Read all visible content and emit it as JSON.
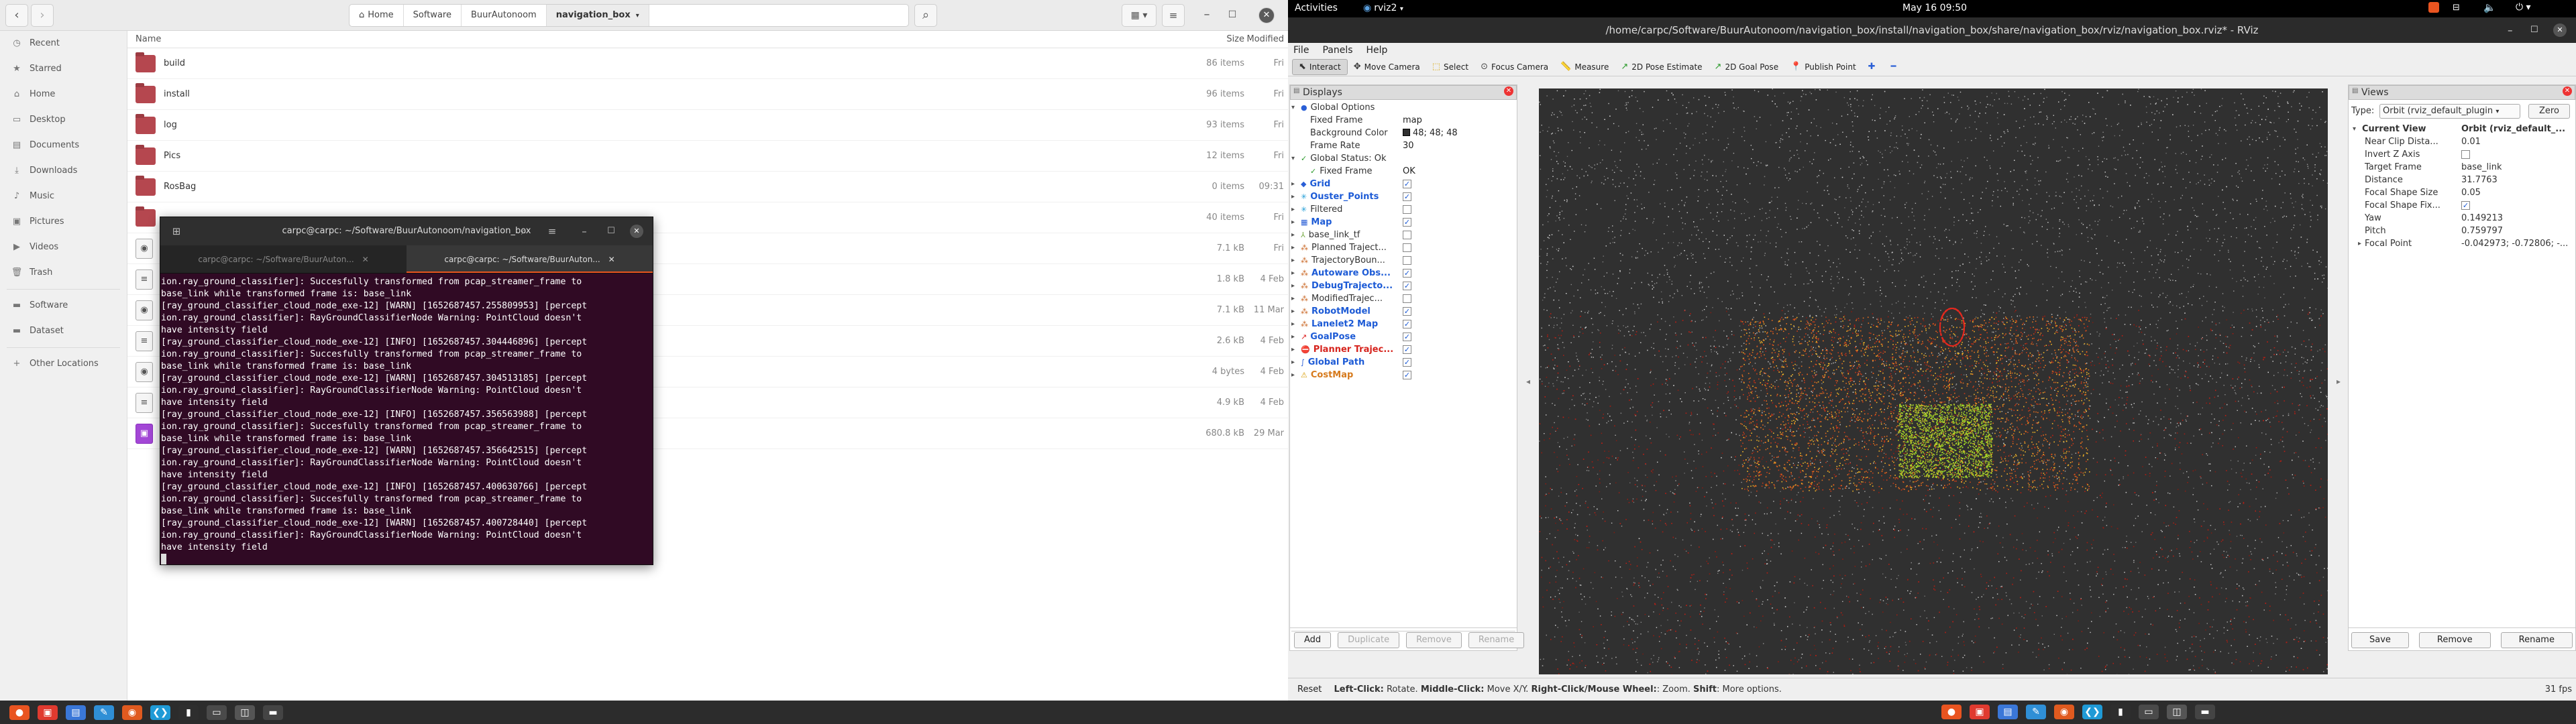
{
  "files": {
    "path": [
      "Home",
      "Software",
      "BuurAutonoom",
      "navigation_box"
    ],
    "columns": {
      "name": "Name",
      "size": "Size",
      "modified": "Modified"
    },
    "sidebar": [
      {
        "label": "Recent",
        "icon": "clock-icon"
      },
      {
        "label": "Starred",
        "icon": "star-icon"
      },
      {
        "label": "Home",
        "icon": "home-icon"
      },
      {
        "label": "Desktop",
        "icon": "desktop-icon"
      },
      {
        "label": "Documents",
        "icon": "document-icon"
      },
      {
        "label": "Downloads",
        "icon": "download-icon"
      },
      {
        "label": "Music",
        "icon": "music-icon"
      },
      {
        "label": "Pictures",
        "icon": "picture-icon"
      },
      {
        "label": "Videos",
        "icon": "video-icon"
      },
      {
        "label": "Trash",
        "icon": "trash-icon"
      },
      {
        "label": "Software",
        "icon": "folder-icon"
      },
      {
        "label": "Dataset",
        "icon": "folder-icon"
      },
      {
        "label": "Other Locations",
        "icon": "plus-icon"
      }
    ],
    "rows": [
      {
        "name": "build",
        "size": "86 items",
        "modified": "Fri",
        "kind": "folder"
      },
      {
        "name": "install",
        "size": "96 items",
        "modified": "Fri",
        "kind": "folder"
      },
      {
        "name": "log",
        "size": "93 items",
        "modified": "Fri",
        "kind": "folder"
      },
      {
        "name": "Pics",
        "size": "12 items",
        "modified": "Fri",
        "kind": "folder"
      },
      {
        "name": "RosBag",
        "size": "0 items",
        "modified": "09:31",
        "kind": "folder"
      },
      {
        "name": "",
        "size": "40 items",
        "modified": "Fri",
        "kind": "folder"
      },
      {
        "name": "",
        "size": "7.1 kB",
        "modified": "Fri",
        "kind": "file"
      },
      {
        "name": "",
        "size": "1.8 kB",
        "modified": "4 Feb",
        "kind": "file"
      },
      {
        "name": "",
        "size": "7.1 kB",
        "modified": "11 Mar",
        "kind": "file"
      },
      {
        "name": "",
        "size": "2.6 kB",
        "modified": "4 Feb",
        "kind": "file"
      },
      {
        "name": "",
        "size": "4 bytes",
        "modified": "4 Feb",
        "kind": "file"
      },
      {
        "name": "",
        "size": "4.9 kB",
        "modified": "4 Feb",
        "kind": "file"
      },
      {
        "name": "",
        "size": "680.8 kB",
        "modified": "29 Mar",
        "kind": "image"
      }
    ]
  },
  "terminal": {
    "title": "carpc@carpc: ~/Software/BuurAutonoom/navigation_box",
    "tabs": [
      "carpc@carpc: ~/Software/BuurAuton...",
      "carpc@carpc: ~/Software/BuurAuton..."
    ],
    "lines": [
      "ion.ray_ground_classifier]: Succesfully transformed from pcap_streamer_frame to",
      "base_link while transformed frame is: base_link",
      "[ray_ground_classifier_cloud_node_exe-12] [WARN] [1652687457.255809953] [percept",
      "ion.ray_ground_classifier]: RayGroundClassifierNode Warning: PointCloud doesn't",
      "have intensity field",
      "[ray_ground_classifier_cloud_node_exe-12] [INFO] [1652687457.304446896] [percept",
      "ion.ray_ground_classifier]: Succesfully transformed from pcap_streamer_frame to",
      "base_link while transformed frame is: base_link",
      "[ray_ground_classifier_cloud_node_exe-12] [WARN] [1652687457.304513185] [percept",
      "ion.ray_ground_classifier]: RayGroundClassifierNode Warning: PointCloud doesn't",
      "have intensity field",
      "[ray_ground_classifier_cloud_node_exe-12] [INFO] [1652687457.356563988] [percept",
      "ion.ray_ground_classifier]: Succesfully transformed from pcap_streamer_frame to",
      "base_link while transformed frame is: base_link",
      "[ray_ground_classifier_cloud_node_exe-12] [WARN] [1652687457.356642515] [percept",
      "ion.ray_ground_classifier]: RayGroundClassifierNode Warning: PointCloud doesn't",
      "have intensity field",
      "[ray_ground_classifier_cloud_node_exe-12] [INFO] [1652687457.400630766] [percept",
      "ion.ray_ground_classifier]: Succesfully transformed from pcap_streamer_frame to",
      "base_link while transformed frame is: base_link",
      "[ray_ground_classifier_cloud_node_exe-12] [WARN] [1652687457.400728440] [percept",
      "ion.ray_ground_classifier]: RayGroundClassifierNode Warning: PointCloud doesn't",
      "have intensity field"
    ]
  },
  "topbar": {
    "activities": "Activities",
    "app": "rviz2",
    "clock": "May 16  09:50"
  },
  "rviz": {
    "title": "/home/carpc/Software/BuurAutonoom/navigation_box/install/navigation_box/share/navigation_box/rviz/navigation_box.rviz* - RViz",
    "menu": [
      "File",
      "Panels",
      "Help"
    ],
    "tools": [
      {
        "label": "Interact",
        "icon": "cursor-icon",
        "active": true
      },
      {
        "label": "Move Camera",
        "icon": "camera-icon"
      },
      {
        "label": "Select",
        "icon": "select-icon"
      },
      {
        "label": "Focus Camera",
        "icon": "focus-icon"
      },
      {
        "label": "Measure",
        "icon": "ruler-icon"
      },
      {
        "label": "2D Pose Estimate",
        "icon": "pose-icon"
      },
      {
        "label": "2D Goal Pose",
        "icon": "goal-icon"
      },
      {
        "label": "Publish Point",
        "icon": "pin-icon"
      }
    ],
    "displays_title": "Displays",
    "displays": [
      {
        "label": "Global Options",
        "indent": 0,
        "arrow": "▾",
        "icon": "●"
      },
      {
        "label": "Fixed Frame",
        "indent": 1,
        "value": "map"
      },
      {
        "label": "Background Color",
        "indent": 1,
        "value": "48; 48; 48",
        "swatch": "#303030"
      },
      {
        "label": "Frame Rate",
        "indent": 1,
        "value": "30"
      },
      {
        "label": "Global Status: Ok",
        "indent": 0,
        "arrow": "▾",
        "icon": "✓"
      },
      {
        "label": "Fixed Frame",
        "indent": 1,
        "value": "OK",
        "icon": "✓"
      },
      {
        "label": "Grid",
        "indent": 0,
        "arrow": "▸",
        "cls": "blue",
        "check": true,
        "icon": "◆"
      },
      {
        "label": "Ouster_Points",
        "indent": 0,
        "arrow": "▸",
        "cls": "blue",
        "check": true,
        "icon": "✳"
      },
      {
        "label": "Filtered",
        "indent": 0,
        "arrow": "▸",
        "check": false,
        "icon": "✳"
      },
      {
        "label": "Map",
        "indent": 0,
        "arrow": "▸",
        "cls": "blue",
        "check": true,
        "icon": "▦"
      },
      {
        "label": "base_link_tf",
        "indent": 0,
        "arrow": "▸",
        "check": false,
        "icon": "⅄"
      },
      {
        "label": "Planned Traject...",
        "indent": 0,
        "arrow": "▸",
        "check": false,
        "icon": "⁂"
      },
      {
        "label": "TrajectoryBoun...",
        "indent": 0,
        "arrow": "▸",
        "check": false,
        "icon": "⁂"
      },
      {
        "label": "Autoware Obs...",
        "indent": 0,
        "arrow": "▸",
        "cls": "blue",
        "check": true,
        "icon": "⁂"
      },
      {
        "label": "DebugTrajecto...",
        "indent": 0,
        "arrow": "▸",
        "cls": "blue",
        "check": true,
        "icon": "⁂"
      },
      {
        "label": "ModifiedTrajec...",
        "indent": 0,
        "arrow": "▸",
        "check": false,
        "icon": "⁂"
      },
      {
        "label": "RobotModel",
        "indent": 0,
        "arrow": "▸",
        "cls": "blue",
        "check": true,
        "icon": "⁂"
      },
      {
        "label": "Lanelet2 Map",
        "indent": 0,
        "arrow": "▸",
        "cls": "blue",
        "check": true,
        "icon": "⁂"
      },
      {
        "label": "GoalPose",
        "indent": 0,
        "arrow": "▸",
        "cls": "blue",
        "check": true,
        "icon": "↗"
      },
      {
        "label": "Planner Trajec...",
        "indent": 0,
        "arrow": "▸",
        "cls": "red",
        "check": true,
        "icon": "⛔"
      },
      {
        "label": "Global Path",
        "indent": 0,
        "arrow": "▸",
        "cls": "blue",
        "check": true,
        "icon": "∫"
      },
      {
        "label": "CostMap",
        "indent": 0,
        "arrow": "▸",
        "cls": "orange",
        "check": true,
        "icon": "⚠"
      }
    ],
    "display_buttons": [
      {
        "label": "Add",
        "enabled": true
      },
      {
        "label": "Duplicate",
        "enabled": false
      },
      {
        "label": "Remove",
        "enabled": false
      },
      {
        "label": "Rename",
        "enabled": false
      }
    ],
    "views_title": "Views",
    "view_type_label": "Type:",
    "view_type": "Orbit (rviz_default_plugin",
    "zero": "Zero",
    "views": [
      {
        "label": "Current View",
        "value": "Orbit (rviz_default_...",
        "bold": true,
        "arrow": "▾"
      },
      {
        "label": "Near Clip Dista...",
        "value": "0.01"
      },
      {
        "label": "Invert Z Axis",
        "value": "",
        "check": false
      },
      {
        "label": "Target Frame",
        "value": "base_link"
      },
      {
        "label": "Distance",
        "value": "31.7763"
      },
      {
        "label": "Focal Shape Size",
        "value": "0.05"
      },
      {
        "label": "Focal Shape Fix...",
        "value": "",
        "check": true
      },
      {
        "label": "Yaw",
        "value": "0.149213"
      },
      {
        "label": "Pitch",
        "value": "0.759797"
      },
      {
        "label": "Focal Point",
        "value": "-0.042973; -0.72806; -...",
        "arrow": "▸"
      }
    ],
    "view_buttons": [
      "Save",
      "Remove",
      "Rename"
    ],
    "status": {
      "reset": "Reset",
      "hint_bold1": "Left-Click:",
      "hint1": " Rotate. ",
      "hint_bold2": "Middle-Click:",
      "hint2": " Move X/Y. ",
      "hint_bold3": "Right-Click/Mouse Wheel:",
      "hint3": ": Zoom. ",
      "hint_bold4": "Shift",
      "hint4": ": More options.",
      "fps": "31 fps"
    }
  }
}
